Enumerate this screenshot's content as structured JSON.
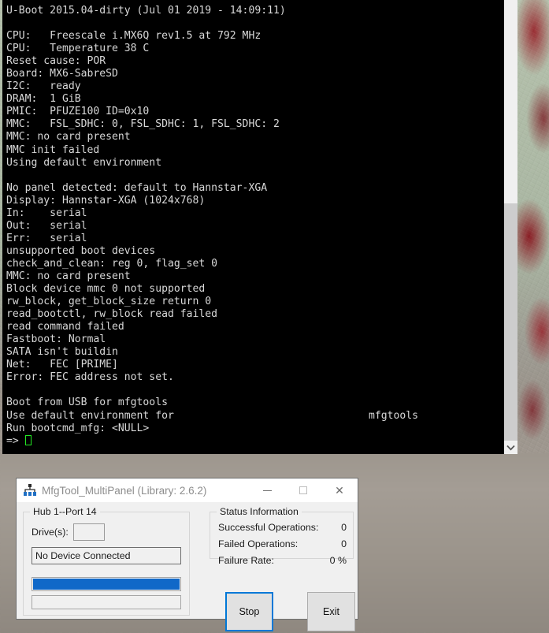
{
  "desktop": {
    "wallpaper_name": "abstract-red-green-wallpaper"
  },
  "terminal": {
    "name": "u-boot-serial-console",
    "prompt_symbol": "=>",
    "right_column_text": "mfgtools",
    "lines": [
      "U-Boot 2015.04-dirty (Jul 01 2019 - 14:09:11)",
      "",
      "CPU:   Freescale i.MX6Q rev1.5 at 792 MHz",
      "CPU:   Temperature 38 C",
      "Reset cause: POR",
      "Board: MX6-SabreSD",
      "I2C:   ready",
      "DRAM:  1 GiB",
      "PMIC:  PFUZE100 ID=0x10",
      "MMC:   FSL_SDHC: 0, FSL_SDHC: 1, FSL_SDHC: 2",
      "MMC: no card present",
      "MMC init failed",
      "Using default environment",
      "",
      "No panel detected: default to Hannstar-XGA",
      "Display: Hannstar-XGA (1024x768)",
      "In:    serial",
      "Out:   serial",
      "Err:   serial",
      "unsupported boot devices",
      "check_and_clean: reg 0, flag_set 0",
      "MMC: no card present",
      "Block device mmc 0 not supported",
      "rw_block, get_block_size return 0",
      "read_bootctl, rw_block read failed",
      "read command failed",
      "Fastboot: Normal",
      "SATA isn't buildin",
      "Net:   FEC [PRIME]",
      "Error: FEC address not set.",
      "",
      "Boot from USB for mfgtools",
      "Use default environment for",
      "Run bootcmd_mfg: <NULL>"
    ],
    "scrollbar": {
      "down_arrow_glyph": "⌄"
    }
  },
  "dialog": {
    "title": "MfgTool_MultiPanel (Library: 2.6.2)",
    "icon": "usb-hub-icon",
    "window_controls": {
      "minimize": "—",
      "maximize": "□",
      "close": "✕"
    },
    "hub_group": {
      "label": "Hub 1--Port 14",
      "drives_label": "Drive(s):",
      "drives_value": "",
      "device_status": "No Device Connected",
      "progress_primary_percent": 100,
      "progress_secondary_percent": 0
    },
    "status_group": {
      "label": "Status Information",
      "rows": [
        {
          "label": "Successful Operations:",
          "value": "0"
        },
        {
          "label": "Failed Operations:",
          "value": "0"
        },
        {
          "label": "Failure Rate:",
          "value": "0 %"
        }
      ]
    },
    "buttons": {
      "stop": "Stop",
      "exit": "Exit"
    },
    "colors": {
      "progress_blue": "#1068c8",
      "focus_blue": "#0078d7",
      "dialog_face": "#f0f0f0"
    }
  }
}
